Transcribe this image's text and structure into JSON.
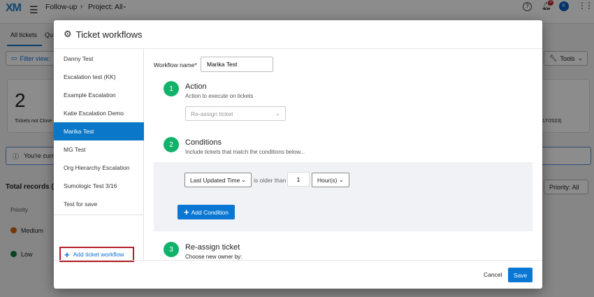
{
  "topbar": {
    "logo": "XM",
    "section": "Follow-up",
    "project": "Project: All",
    "notification_count": "5",
    "avatar_initial": "K"
  },
  "background": {
    "tabs": [
      "All tickets",
      "Qu"
    ],
    "filter_label": "Filter view:",
    "tools_label": "Tools",
    "card_value": "2",
    "card_label": "Tickets not Close",
    "card_date": "17/2023)",
    "info_text": "You're curre",
    "total_records": "Total records (2",
    "priority_filter": "Priority: All",
    "column_priority": "Priority",
    "rows": [
      {
        "label": "Medium",
        "color": "#d4660f"
      },
      {
        "label": "Low",
        "color": "#0f7a3e"
      }
    ]
  },
  "modal": {
    "title": "Ticket workflows",
    "workflows": [
      "Danny Test",
      "Escalation test (KK)",
      "Example Escalation",
      "Katie Escalation Demo",
      "Marika Test",
      "MG Test",
      "Org Hierarchy Escalation",
      "Sumologic Test 3/16",
      "Test for save"
    ],
    "selected_index": 4,
    "add_workflow": "Add ticket workflow",
    "workflow_name_label": "Workflow name*",
    "workflow_name_value": "Marika Test",
    "steps": [
      {
        "num": "1",
        "title": "Action",
        "subtitle": "Action to execute on tickets",
        "select": "Re-assign ticket"
      },
      {
        "num": "2",
        "title": "Conditions",
        "subtitle": "Include tickets that match the conditions below..."
      },
      {
        "num": "3",
        "title": "Re-assign ticket",
        "subtitle": "Choose new owner by:"
      }
    ],
    "condition": {
      "field": "Last Updated Time",
      "operator": "is older than",
      "value": "1",
      "unit": "Hour(s)"
    },
    "add_condition": "Add Condition",
    "cancel": "Cancel",
    "save": "Save"
  },
  "colors": {
    "accent": "#0a77c8",
    "step": "#13b26b",
    "highlight": "#b3202a"
  }
}
